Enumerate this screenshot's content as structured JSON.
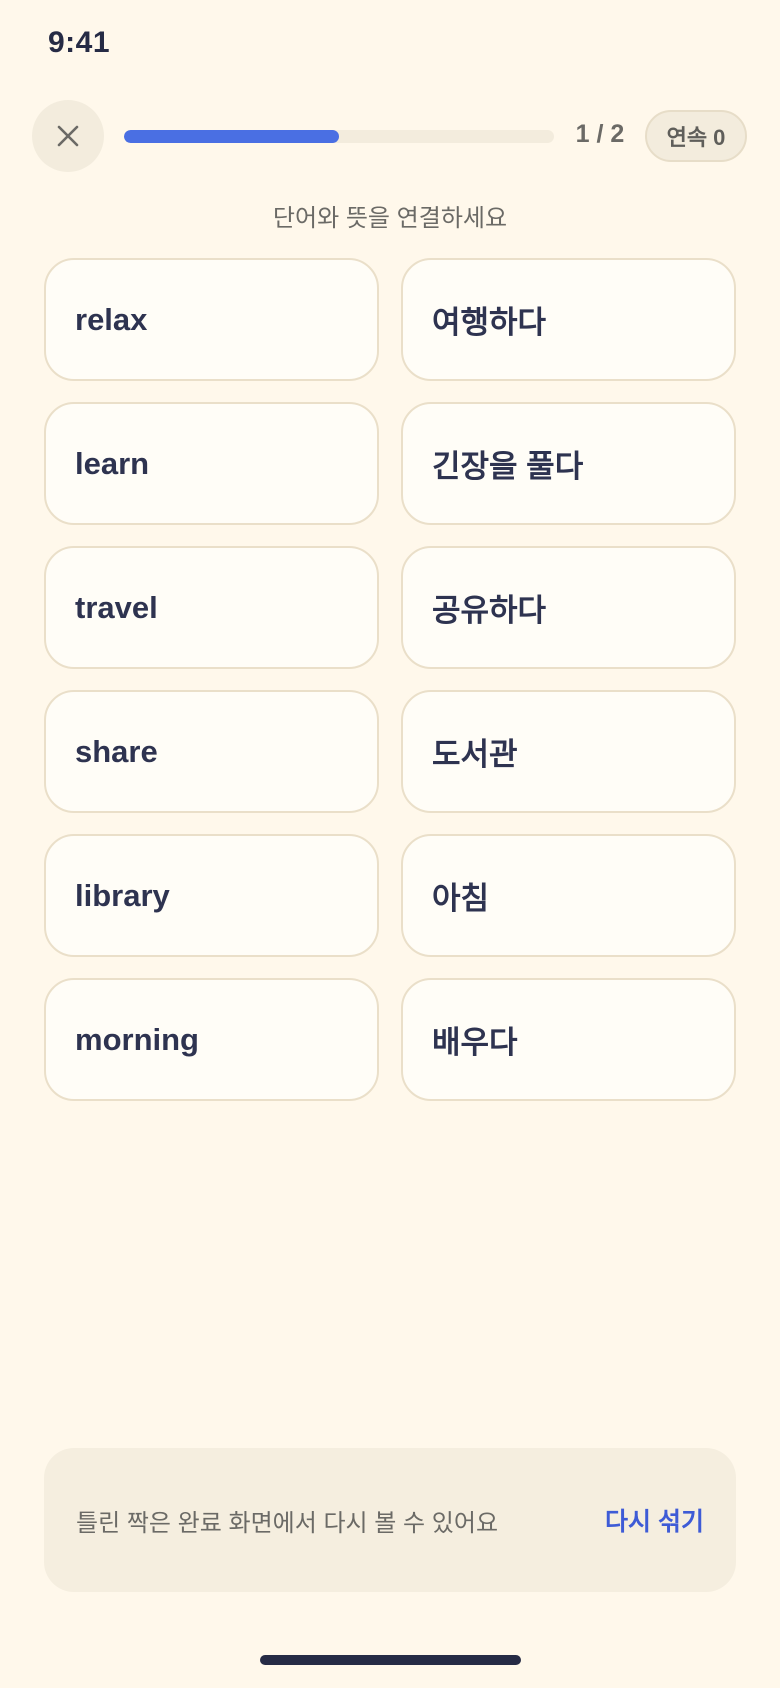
{
  "status_bar": {
    "time": "9:41"
  },
  "header": {
    "close_icon": "close-icon",
    "progress": {
      "text": "1 / 2",
      "fraction": 0.5
    },
    "streak_label": "연속 0"
  },
  "instruction": "단어와 뜻을 연결하세요",
  "words": [
    "relax",
    "learn",
    "travel",
    "share",
    "library",
    "morning"
  ],
  "meanings": [
    "여행하다",
    "긴장을 풀다",
    "공유하다",
    "도서관",
    "아침",
    "배우다"
  ],
  "footer": {
    "note": "틀린 짝은 완료 화면에서 다시 볼 수 있어요",
    "reshuffle_label": "다시 섞기"
  },
  "colors": {
    "accent": "#4A6FE3",
    "link": "#3E5BD6",
    "background": "#FFF8EB"
  }
}
